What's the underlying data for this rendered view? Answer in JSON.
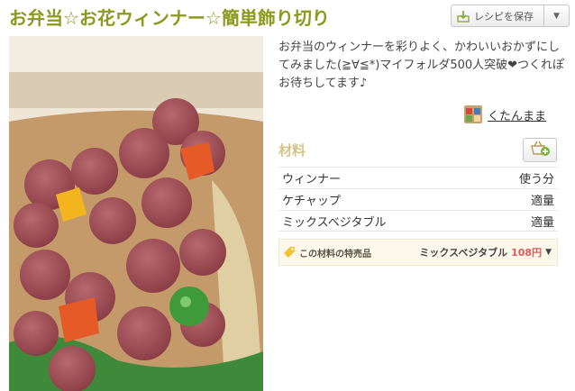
{
  "recipe": {
    "title": "お弁当☆お花ウィンナー☆簡単飾り切り",
    "description": "お弁当のウィンナーを彩りよく、かわいいおかずにしてみました(≧∀≦*)マイフォルダ500人突破❤つくれぽお待ちしてます♪",
    "author": "くたんまま"
  },
  "toolbar": {
    "save_label": "レシピを保存",
    "menu_arrow": "▼"
  },
  "ingredients": {
    "heading": "材料",
    "items": [
      {
        "name": "ウィンナー",
        "qty": "使う分"
      },
      {
        "name": "ケチャップ",
        "qty": "適量"
      },
      {
        "name": "ミックスベジタブル",
        "qty": "適量"
      }
    ]
  },
  "promo": {
    "label": "この材料の特売品",
    "product": "ミックスベジタブル",
    "price": "108円",
    "caret": "▼"
  },
  "colors": {
    "title": "#8a9a1c",
    "heading": "#d6c48a",
    "price": "#e2585c"
  },
  "icons": {
    "save": "download-arrow-icon",
    "add": "basket-plus-icon",
    "promo": "tag-icon"
  }
}
